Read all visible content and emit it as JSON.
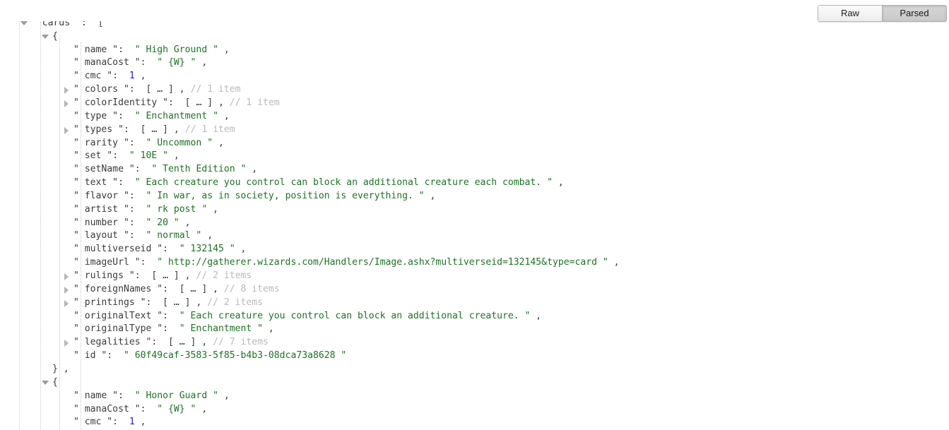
{
  "toolbar": {
    "raw_label": "Raw",
    "parsed_label": "Parsed",
    "active": "Parsed"
  },
  "json": {
    "rows": [
      {
        "indent": 0,
        "twisty": "open",
        "text": "{"
      },
      {
        "indent": 1,
        "twisty": "open",
        "key": "cards",
        "after": "["
      },
      {
        "indent": 2,
        "twisty": "open",
        "text": "{"
      },
      {
        "indent": 3,
        "twisty": "none",
        "key": "name",
        "str": "High Ground",
        "comma": true
      },
      {
        "indent": 3,
        "twisty": "none",
        "key": "manaCost",
        "str": "{W}",
        "comma": true
      },
      {
        "indent": 3,
        "twisty": "none",
        "key": "cmc",
        "num": "1",
        "comma": true
      },
      {
        "indent": 3,
        "twisty": "closed",
        "key": "colors",
        "ellipsis": "[ … ]",
        "comma": true,
        "comment": "// 1 item"
      },
      {
        "indent": 3,
        "twisty": "closed",
        "key": "colorIdentity",
        "ellipsis": "[ … ]",
        "comma": true,
        "comment": "// 1 item"
      },
      {
        "indent": 3,
        "twisty": "none",
        "key": "type",
        "str": "Enchantment",
        "comma": true
      },
      {
        "indent": 3,
        "twisty": "closed",
        "key": "types",
        "ellipsis": "[ … ]",
        "comma": true,
        "comment": "// 1 item"
      },
      {
        "indent": 3,
        "twisty": "none",
        "key": "rarity",
        "str": "Uncommon",
        "comma": true
      },
      {
        "indent": 3,
        "twisty": "none",
        "key": "set",
        "str": "10E",
        "comma": true
      },
      {
        "indent": 3,
        "twisty": "none",
        "key": "setName",
        "str": "Tenth Edition",
        "comma": true
      },
      {
        "indent": 3,
        "twisty": "none",
        "key": "text",
        "str": "Each creature you control can block an additional creature each combat.",
        "comma": true
      },
      {
        "indent": 3,
        "twisty": "none",
        "key": "flavor",
        "str": "In war, as in society, position is everything.",
        "comma": true
      },
      {
        "indent": 3,
        "twisty": "none",
        "key": "artist",
        "str": "rk post",
        "comma": true
      },
      {
        "indent": 3,
        "twisty": "none",
        "key": "number",
        "str": "20",
        "comma": true
      },
      {
        "indent": 3,
        "twisty": "none",
        "key": "layout",
        "str": "normal",
        "comma": true
      },
      {
        "indent": 3,
        "twisty": "none",
        "key": "multiverseid",
        "str": "132145",
        "comma": true
      },
      {
        "indent": 3,
        "twisty": "none",
        "key": "imageUrl",
        "str": "http://gatherer.wizards.com/Handlers/Image.ashx?multiverseid=132145&type=card",
        "comma": true
      },
      {
        "indent": 3,
        "twisty": "closed",
        "key": "rulings",
        "ellipsis": "[ … ]",
        "comma": true,
        "comment": "// 2 items"
      },
      {
        "indent": 3,
        "twisty": "closed",
        "key": "foreignNames",
        "ellipsis": "[ … ]",
        "comma": true,
        "comment": "// 8 items"
      },
      {
        "indent": 3,
        "twisty": "closed",
        "key": "printings",
        "ellipsis": "[ … ]",
        "comma": true,
        "comment": "// 2 items"
      },
      {
        "indent": 3,
        "twisty": "none",
        "key": "originalText",
        "str": "Each creature you control can block an additional creature.",
        "comma": true
      },
      {
        "indent": 3,
        "twisty": "none",
        "key": "originalType",
        "str": "Enchantment",
        "comma": true
      },
      {
        "indent": 3,
        "twisty": "closed",
        "key": "legalities",
        "ellipsis": "[ … ]",
        "comma": true,
        "comment": "// 7 items"
      },
      {
        "indent": 3,
        "twisty": "none",
        "key": "id",
        "str": "60f49caf-3583-5f85-b4b3-08dca73a8628",
        "comma": false
      },
      {
        "indent": 2,
        "twisty": "none",
        "text": "} ,"
      },
      {
        "indent": 2,
        "twisty": "open",
        "text": "{"
      },
      {
        "indent": 3,
        "twisty": "none",
        "key": "name",
        "str": "Honor Guard",
        "comma": true
      },
      {
        "indent": 3,
        "twisty": "none",
        "key": "manaCost",
        "str": "{W}",
        "comma": true
      },
      {
        "indent": 3,
        "twisty": "none",
        "key": "cmc",
        "num": "1",
        "comma": true
      }
    ],
    "guides": [
      27,
      57,
      84,
      114
    ]
  }
}
